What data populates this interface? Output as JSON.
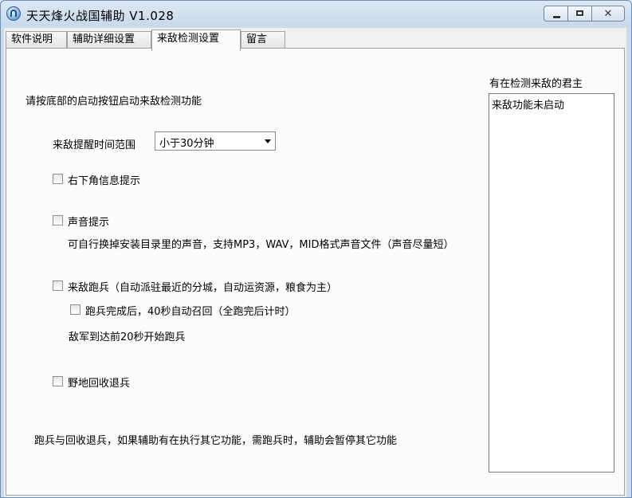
{
  "window": {
    "title": "天天烽火战国辅助 V1.028"
  },
  "tabs": [
    {
      "label": "软件说明"
    },
    {
      "label": "辅助详细设置"
    },
    {
      "label": "来敌检测设置"
    },
    {
      "label": "留言"
    }
  ],
  "panel": {
    "intro": "请按底部的启动按钮启动来敌检测功能",
    "time_range_label": "来敌提醒时间范围",
    "time_range_value": "小于30分钟",
    "options": {
      "corner_notice": "右下角信息提示",
      "sound_notice": "声音提示",
      "sound_hint": "可自行换掉安装目录里的声音，支持MP3，WAV，MID格式声音文件（声音尽量短）",
      "evade": "来敌跑兵（自动派驻最近的分城，自动运资源，粮食为主）",
      "evade_recall": "跑兵完成后，40秒自动召回（全跑完后计时）",
      "evade_timing": "敌军到达前20秒开始跑兵",
      "recycle": "野地回收退兵"
    },
    "footer_note": "跑兵与回收退兵，如果辅助有在执行其它功能，需跑兵时，辅助会暂停其它功能"
  },
  "side": {
    "title": "有在检测来敌的君主",
    "items": [
      "来敌功能未启动"
    ]
  }
}
